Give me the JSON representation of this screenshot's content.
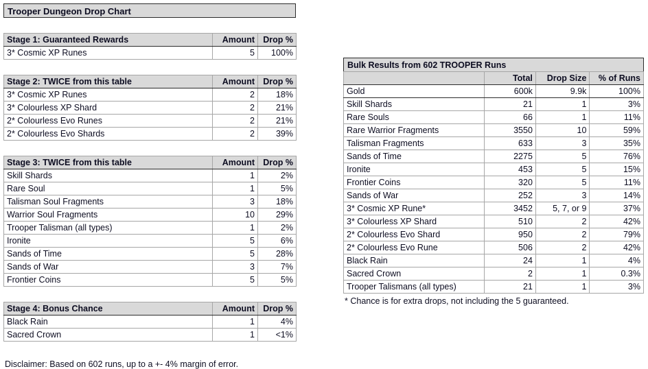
{
  "title": "Trooper Dungeon Drop Chart",
  "stage_columns": [
    "",
    "Amount",
    "Drop %"
  ],
  "stages": [
    {
      "header": "Stage 1: Guaranteed Rewards",
      "amount_header": "Amount",
      "percent_header": "Drop %",
      "rows": [
        {
          "name": "3* Cosmic XP Runes",
          "amount": "5",
          "percent": "100%"
        }
      ]
    },
    {
      "header": "Stage 2: TWICE from this table",
      "amount_header": "Amount",
      "percent_header": "Drop %",
      "rows": [
        {
          "name": "3* Cosmic XP Runes",
          "amount": "2",
          "percent": "18%"
        },
        {
          "name": "3* Colourless XP Shard",
          "amount": "2",
          "percent": "21%"
        },
        {
          "name": "2* Colourless Evo Runes",
          "amount": "2",
          "percent": "21%"
        },
        {
          "name": "2* Colourless Evo Shards",
          "amount": "2",
          "percent": "39%"
        }
      ]
    },
    {
      "header": "Stage 3: TWICE from this table",
      "amount_header": "Amount",
      "percent_header": "Drop %",
      "rows": [
        {
          "name": "Skill Shards",
          "amount": "1",
          "percent": "2%"
        },
        {
          "name": "Rare Soul",
          "amount": "1",
          "percent": "5%"
        },
        {
          "name": "Talisman Soul Fragments",
          "amount": "3",
          "percent": "18%"
        },
        {
          "name": "Warrior Soul Fragments",
          "amount": "10",
          "percent": "29%"
        },
        {
          "name": "Trooper Talisman (all types)",
          "amount": "1",
          "percent": "2%"
        },
        {
          "name": "Ironite",
          "amount": "5",
          "percent": "6%"
        },
        {
          "name": "Sands of Time",
          "amount": "5",
          "percent": "28%"
        },
        {
          "name": "Sands of War",
          "amount": "3",
          "percent": "7%"
        },
        {
          "name": "Frontier Coins",
          "amount": "5",
          "percent": "5%"
        }
      ]
    },
    {
      "header": "Stage 4: Bonus Chance",
      "amount_header": "Amount",
      "percent_header": "Drop %",
      "rows": [
        {
          "name": "Black Rain",
          "amount": "1",
          "percent": "4%"
        },
        {
          "name": "Sacred Crown",
          "amount": "1",
          "percent": "<1%"
        }
      ]
    }
  ],
  "disclaimer": "Disclaimer: Based on 602 runs, up to a +- 4% margin of error.",
  "bulk": {
    "title": "Bulk Results from 602 TROOPER Runs",
    "columns": [
      "",
      "Total",
      "Drop Size",
      "% of Runs"
    ],
    "rows": [
      {
        "name": "Gold",
        "total": "600k",
        "size": "9.9k",
        "percent": "100%"
      },
      {
        "name": "Skill Shards",
        "total": "21",
        "size": "1",
        "percent": "3%"
      },
      {
        "name": "Rare Souls",
        "total": "66",
        "size": "1",
        "percent": "11%"
      },
      {
        "name": "Rare Warrior Fragments",
        "total": "3550",
        "size": "10",
        "percent": "59%"
      },
      {
        "name": "Talisman Fragments",
        "total": "633",
        "size": "3",
        "percent": "35%"
      },
      {
        "name": "Sands of Time",
        "total": "2275",
        "size": "5",
        "percent": "76%"
      },
      {
        "name": "Ironite",
        "total": "453",
        "size": "5",
        "percent": "15%"
      },
      {
        "name": "Frontier Coins",
        "total": "320",
        "size": "5",
        "percent": "11%"
      },
      {
        "name": "Sands of War",
        "total": "252",
        "size": "3",
        "percent": "14%"
      },
      {
        "name": "3* Cosmic XP Rune*",
        "total": "3452",
        "size": "5, 7, or 9",
        "percent": "37%"
      },
      {
        "name": "3* Colourless XP Shard",
        "total": "510",
        "size": "2",
        "percent": "42%"
      },
      {
        "name": "2* Colourless Evo Shard",
        "total": "950",
        "size": "2",
        "percent": "79%"
      },
      {
        "name": "2* Colourless Evo Rune",
        "total": "506",
        "size": "2",
        "percent": "42%"
      },
      {
        "name": "Black Rain",
        "total": "24",
        "size": "1",
        "percent": "4%"
      },
      {
        "name": "Sacred Crown",
        "total": "2",
        "size": "1",
        "percent": "0.3%"
      },
      {
        "name": "Trooper Talismans (all types)",
        "total": "21",
        "size": "1",
        "percent": "3%"
      }
    ],
    "footnote": "* Chance is for extra drops, not including the 5 guaranteed."
  },
  "colors": {
    "header_bg": "#d9d9d9",
    "border_outer": "#2b2b2b",
    "border_inner": "#a6a6a6",
    "text": "#0d0d21",
    "page_bg": "#ffffff"
  }
}
